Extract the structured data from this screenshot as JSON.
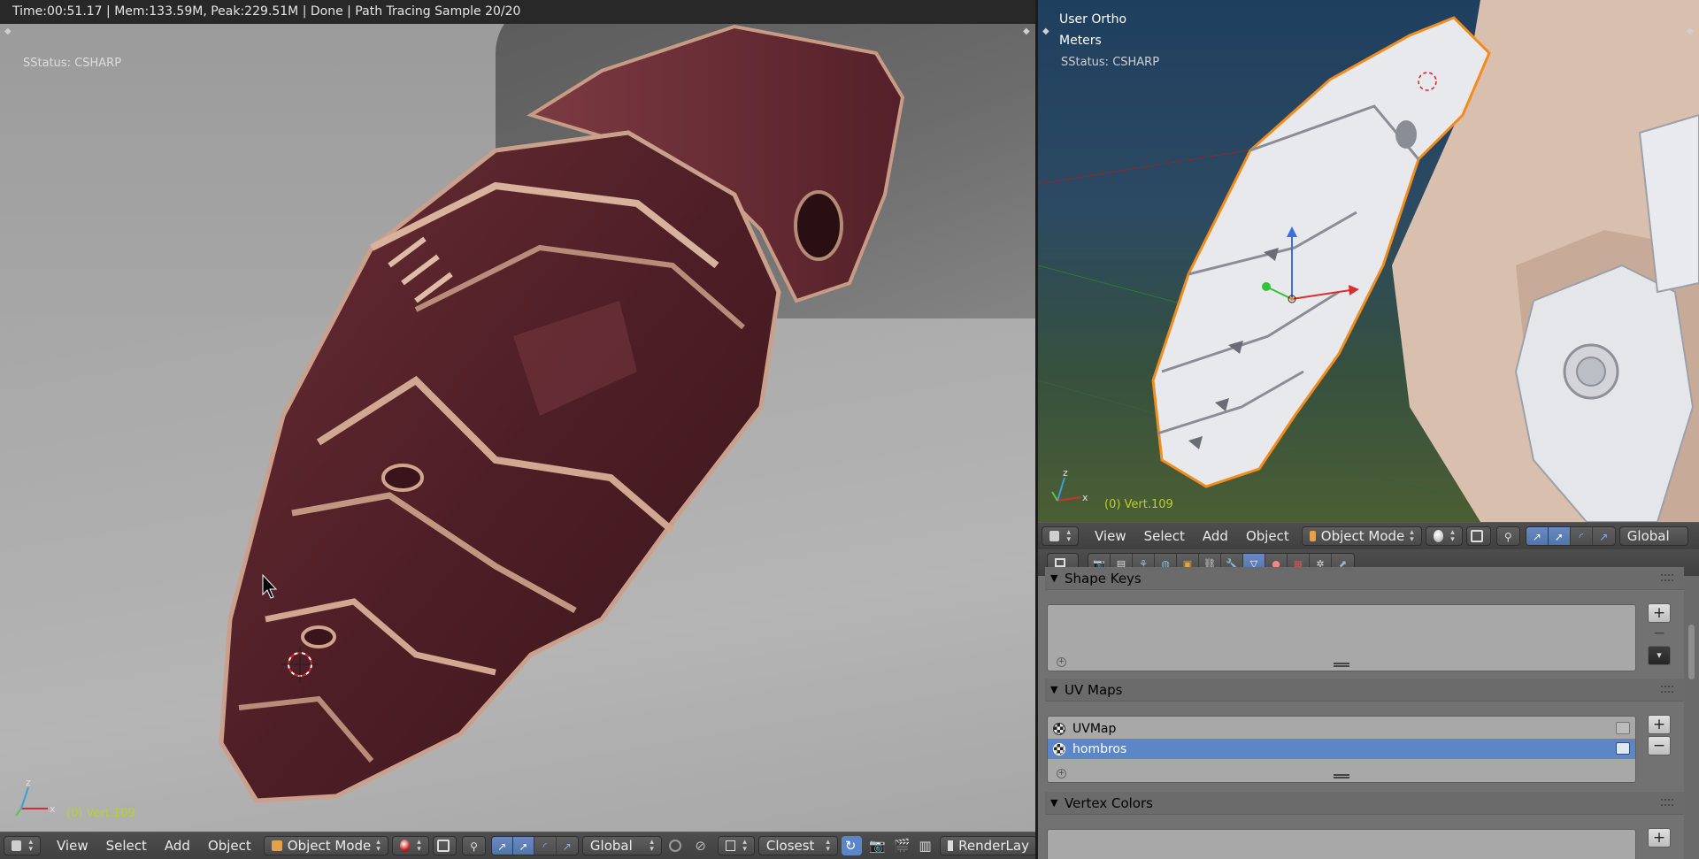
{
  "left_viewport": {
    "render_status": "Time:00:51.17 | Mem:133.59M, Peak:229.51M | Done | Path Tracing Sample 20/20",
    "overlay_status": "SStatus: CSHARP",
    "vert_label": "(0) Vert.109",
    "axis_labels": {
      "x": "x",
      "z": "z"
    }
  },
  "right_viewport": {
    "view_name": "User Ortho",
    "units": "Meters",
    "overlay_status": "SStatus: CSHARP",
    "vert_label": "(0) Vert.109",
    "axis_labels": {
      "x": "x",
      "z": "z"
    }
  },
  "left_header": {
    "menus": [
      "View",
      "Select",
      "Add",
      "Object"
    ],
    "mode": "Object Mode",
    "orientation": "Global",
    "snap_target": "Closest",
    "render_layer": "RenderLay"
  },
  "right_header": {
    "menus": [
      "View",
      "Select",
      "Add",
      "Object"
    ],
    "mode": "Object Mode",
    "orientation": "Global"
  },
  "properties": {
    "shape_keys_title": "Shape Keys",
    "uv_maps_title": "UV Maps",
    "uv_maps": [
      {
        "name": "UVMap",
        "selected": false
      },
      {
        "name": "hombros",
        "selected": true
      }
    ],
    "vertex_colors_title": "Vertex Colors"
  },
  "colors": {
    "selection_blue": "#5b87c9",
    "vert_label": "#b8d02e",
    "status_bar": "#282828"
  }
}
